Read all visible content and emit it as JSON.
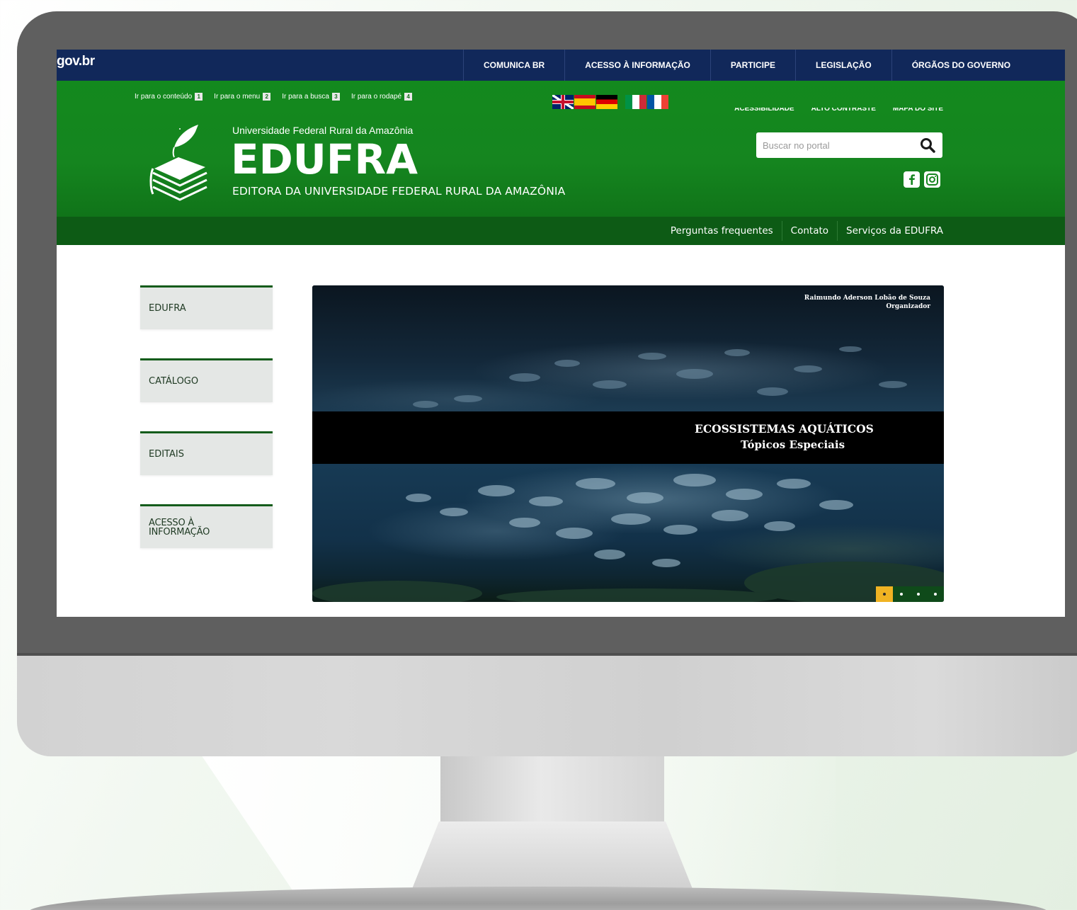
{
  "govbar": {
    "logo": "gov.br",
    "nav": [
      "COMUNICA BR",
      "ACESSO À INFORMAÇÃO",
      "PARTICIPE",
      "LEGISLAÇÃO",
      "ÓRGÃOS DO GOVERNO"
    ]
  },
  "accessibility_links": [
    {
      "label": "Ir para o conteúdo",
      "key": "1"
    },
    {
      "label": "Ir para o menu",
      "key": "2"
    },
    {
      "label": "Ir para a busca",
      "key": "3"
    },
    {
      "label": "Ir para o rodapé",
      "key": "4"
    }
  ],
  "languages": [
    "uk-flag-icon",
    "es-flag-icon",
    "de-flag-icon",
    "it-flag-icon",
    "fr-flag-icon"
  ],
  "top_right_links": [
    "ACESSIBILIDADE",
    "ALTO CONTRASTE",
    "MAPA DO SITE"
  ],
  "header": {
    "university": "Universidade Federal Rural da Amazônia",
    "brand": "EDUFRA",
    "subtitle": "EDITORA DA UNIVERSIDADE FEDERAL RURAL DA AMAZÔNIA"
  },
  "search": {
    "placeholder": "Buscar no portal",
    "value": ""
  },
  "social": [
    "facebook-icon",
    "instagram-icon"
  ],
  "subnav": [
    "Perguntas frequentes",
    "Contato",
    "Serviços da EDUFRA"
  ],
  "side_menu": [
    "EDUFRA",
    "CATÁLOGO",
    "EDITAIS",
    "ACESSO À INFORMAÇÃO"
  ],
  "carousel": {
    "author": "Raimundo Aderson Lobão de Souza",
    "author_role": "Organizador",
    "title": "ECOSSISTEMAS AQUÁTICOS",
    "subtitle": "Tópicos Especiais",
    "slides": 4,
    "active_slide": 1
  },
  "colors": {
    "gov_blue": "#11285a",
    "header_green": "#13891e",
    "subnav_green": "#0d5b15",
    "active_dot": "#f0b323"
  }
}
